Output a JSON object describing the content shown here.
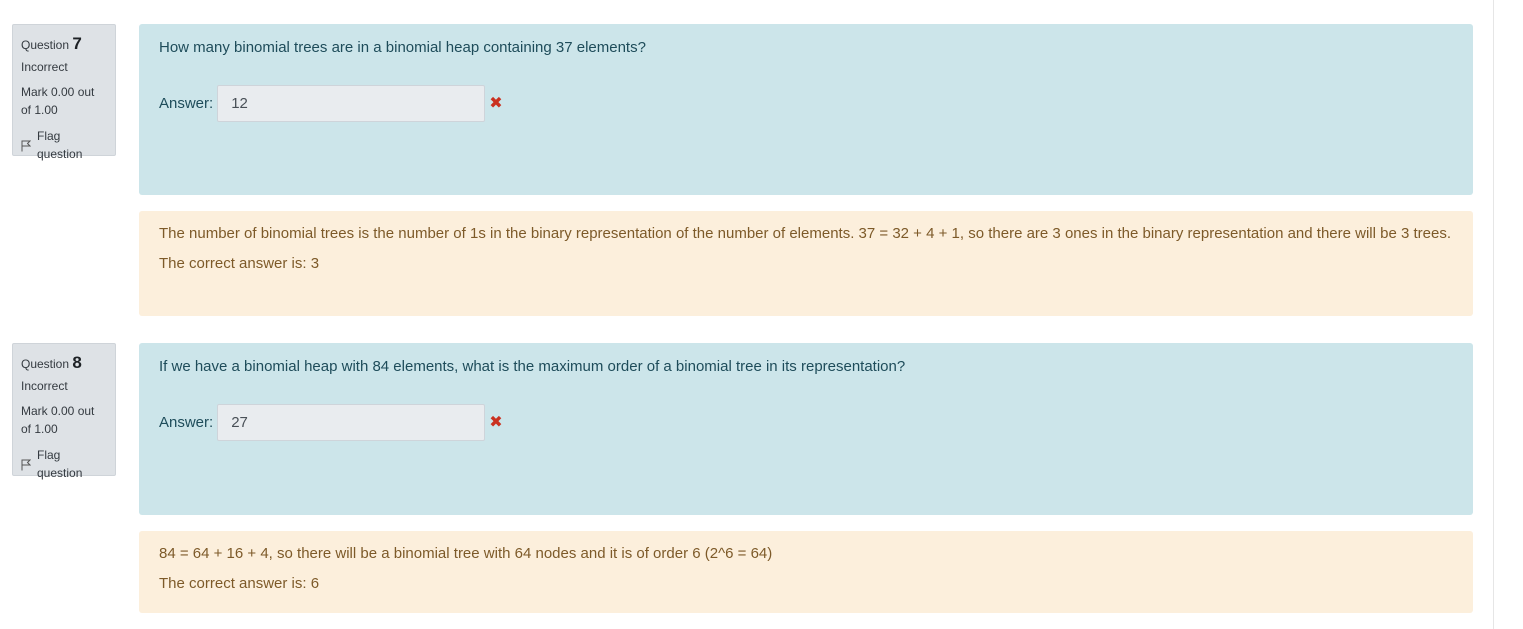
{
  "questions": [
    {
      "label": "Question",
      "number": "7",
      "state": "Incorrect",
      "grade": "Mark 0.00 out of 1.00",
      "flag": "Flag question",
      "text": "How many binomial trees are in a binomial heap containing 37 elements?",
      "answer_label": "Answer:",
      "answer_value": "12",
      "feedback": "The number of binomial trees is the number of 1s in the binary representation of the number of elements. 37 = 32 + 4 + 1, so there are 3 ones in the binary representation and there will be 3 trees.",
      "right_answer": "The correct answer is: 3"
    },
    {
      "label": "Question",
      "number": "8",
      "state": "Incorrect",
      "grade": "Mark 0.00 out of 1.00",
      "flag": "Flag question",
      "text": "If we have a binomial heap with 84 elements, what is the maximum order of a binomial tree in its representation?",
      "answer_label": "Answer:",
      "answer_value": "27",
      "feedback": "84 = 64 + 16 + 4, so there will be a binomial tree with 64 nodes and it is of order 6 (2^6 = 64)",
      "right_answer": "The correct answer is: 6"
    }
  ],
  "icons": {
    "flag": "flag-outline-icon",
    "incorrect": "red-x-icon"
  },
  "colors": {
    "formulation_bg": "#cce5ea",
    "feedback_bg": "#fcefdc",
    "info_bg": "#dee2e6",
    "incorrect": "#ca3120"
  }
}
